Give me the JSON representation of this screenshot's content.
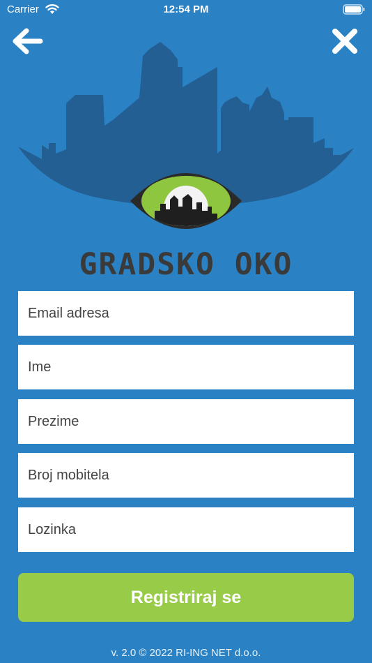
{
  "status_bar": {
    "carrier": "Carrier",
    "time": "12:54 PM",
    "icons": [
      "wifi-icon",
      "battery-icon"
    ]
  },
  "nav": {
    "back_icon": "arrow-left-icon",
    "close_icon": "close-icon"
  },
  "logo": {
    "brand_text": "GRADSKO OKO",
    "colors": {
      "skyline": "#235f92",
      "eye_iris": "#8fc63f",
      "eye_outline": "#333333"
    }
  },
  "form": {
    "email_placeholder": "Email adresa",
    "first_name_placeholder": "Ime",
    "last_name_placeholder": "Prezime",
    "phone_placeholder": "Broj mobitela",
    "password_placeholder": "Lozinka",
    "submit_label": "Registriraj se"
  },
  "footer": {
    "text": "v. 2.0 © 2022 RI-ING NET d.o.o."
  },
  "colors": {
    "background": "#2a82c4",
    "accent": "#97cb48",
    "field_bg": "#ffffff"
  }
}
